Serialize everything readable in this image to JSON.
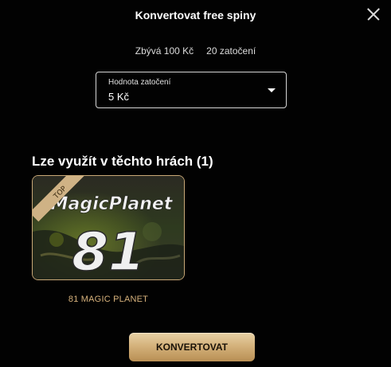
{
  "modal": {
    "title": "Konvertovat free spiny"
  },
  "summary": {
    "remaining": "Zbývá 100 Kč",
    "spins": "20 zatočení"
  },
  "spin_value": {
    "label": "Hodnota zatočení",
    "selected": "5 Kč"
  },
  "games_section": {
    "title": "Lze využít v těchto hrách (1)",
    "games": [
      {
        "name": "81 MAGIC PLANET",
        "logo_text": "MagicPlanet",
        "number": "81",
        "ribbon": "TOP"
      }
    ]
  },
  "actions": {
    "convert_label": "KONVERTOVAT"
  },
  "colors": {
    "background": "#020202",
    "gold": "#d7b27c",
    "card_border": "#c9a877"
  }
}
